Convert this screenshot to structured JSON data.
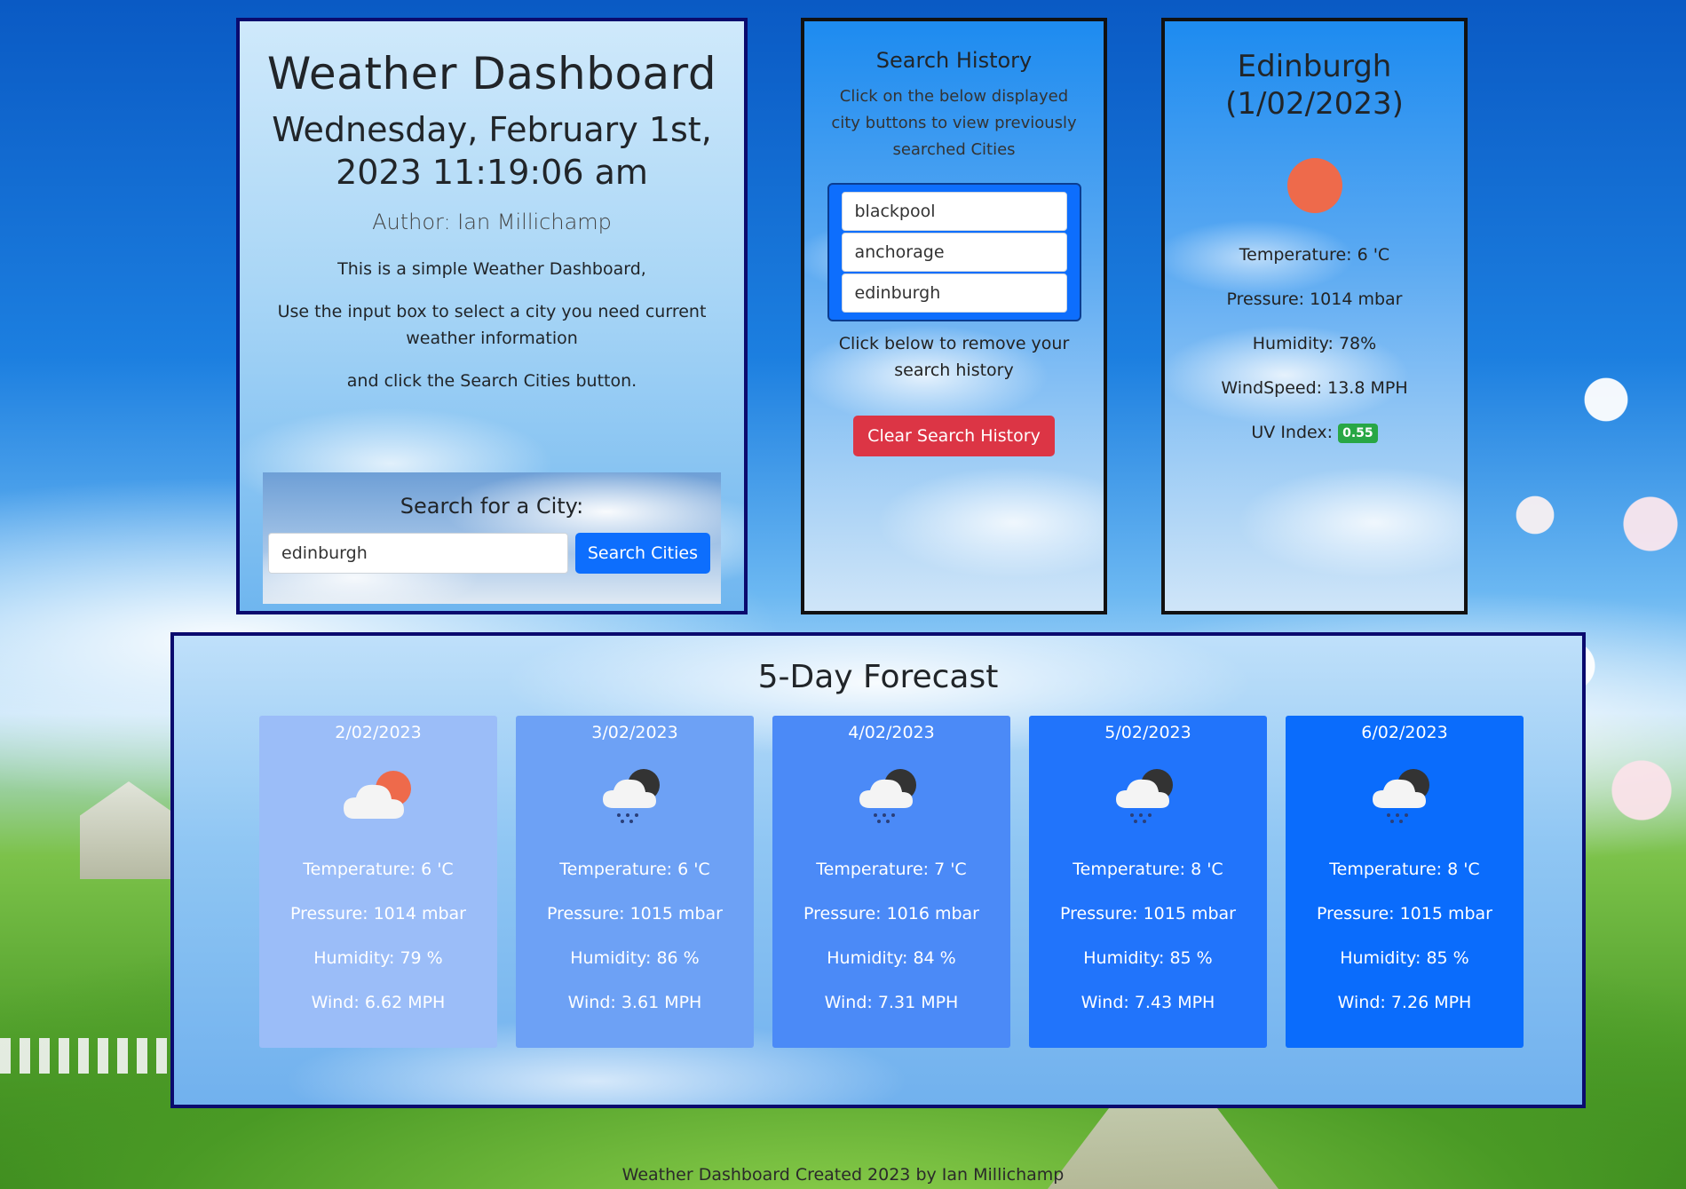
{
  "main": {
    "title": "Weather Dashboard",
    "datetime": "Wednesday, February 1st, 2023 11:19:06 am",
    "author": "Author: Ian Millichamp",
    "desc1": "This is a simple Weather Dashboard,",
    "desc2": "Use the input box to select a city you need current weather information",
    "desc3": "and click the Search Cities button.",
    "search_heading": "Search for a City:",
    "search_value": "edinburgh",
    "search_button": "Search Cities"
  },
  "history": {
    "title": "Search History",
    "help": "Click on the below displayed city buttons to view previously searched Cities",
    "cities": [
      "blackpool",
      "anchorage",
      "edinburgh"
    ],
    "remove_help": "Click below to remove your search history",
    "clear_button": "Clear Search History"
  },
  "current": {
    "city": "Edinburgh",
    "date": "(1/02/2023)",
    "icon": "sun-icon",
    "temperature": "Temperature: 6 'C",
    "pressure": "Pressure: 1014 mbar",
    "humidity": "Humidity: 78%",
    "windspeed": "WindSpeed: 13.8 MPH",
    "uv_label": "UV Index:",
    "uv_value": "0.55",
    "uv_color": "#28a745"
  },
  "forecast": {
    "title": "5-Day Forecast",
    "days": [
      {
        "date": "2/02/2023",
        "icon": "partly-cloudy-icon",
        "temperature": "Temperature: 6 'C",
        "pressure": "Pressure: 1014 mbar",
        "humidity": "Humidity: 79 %",
        "wind": "Wind: 6.62 MPH",
        "color": "#9bbdf8"
      },
      {
        "date": "3/02/2023",
        "icon": "rain-cloud-icon",
        "temperature": "Temperature: 6 'C",
        "pressure": "Pressure: 1015 mbar",
        "humidity": "Humidity: 86 %",
        "wind": "Wind: 3.61 MPH",
        "color": "#6da1f5"
      },
      {
        "date": "4/02/2023",
        "icon": "rain-cloud-icon",
        "temperature": "Temperature: 7 'C",
        "pressure": "Pressure: 1016 mbar",
        "humidity": "Humidity: 84 %",
        "wind": "Wind: 7.31 MPH",
        "color": "#4b8af7"
      },
      {
        "date": "5/02/2023",
        "icon": "rain-cloud-icon",
        "temperature": "Temperature: 8 'C",
        "pressure": "Pressure: 1015 mbar",
        "humidity": "Humidity: 85 %",
        "wind": "Wind: 7.43 MPH",
        "color": "#2174fb"
      },
      {
        "date": "6/02/2023",
        "icon": "rain-cloud-icon",
        "temperature": "Temperature: 8 'C",
        "pressure": "Pressure: 1015 mbar",
        "humidity": "Humidity: 85 %",
        "wind": "Wind: 7.26 MPH",
        "color": "#0a6cfc"
      }
    ]
  },
  "footer": "Weather Dashboard Created 2023 by Ian Millichamp"
}
